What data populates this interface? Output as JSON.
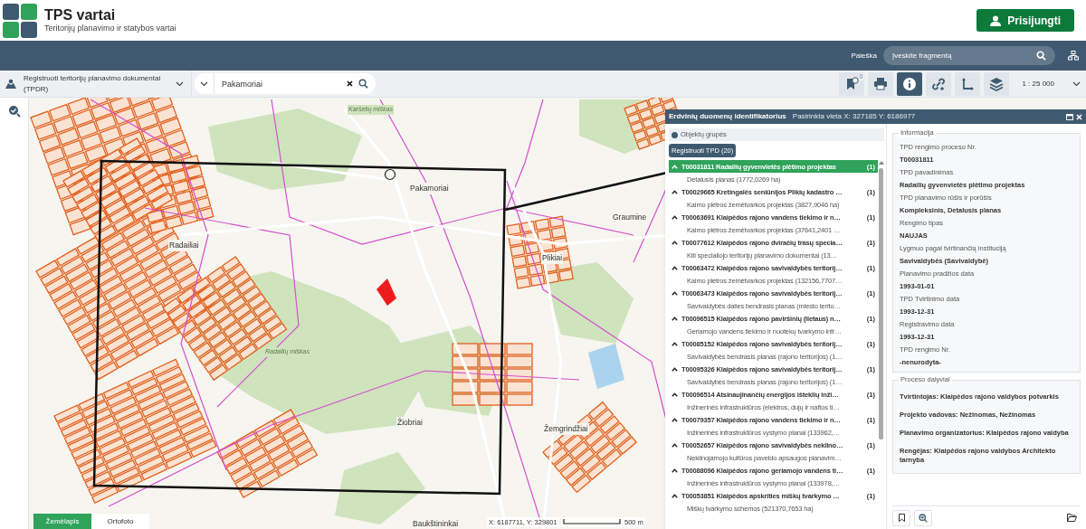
{
  "header": {
    "title": "TPS vartai",
    "subtitle": "Teritorijų planavimo ir statybos vartai",
    "login_button": "Prisijungti"
  },
  "nav_bar": {
    "search_label": "Paieška",
    "search_placeholder": "Įveskite fragmentą"
  },
  "toolbar": {
    "layer_select": "Registruoti teritorijų planavimo dokumentai (TPDR)",
    "search_value": "Pakamoriai",
    "tools": [
      {
        "kind": "bookmark",
        "badge": "0",
        "selected": false
      },
      {
        "kind": "print",
        "selected": false
      },
      {
        "kind": "info",
        "selected": true
      },
      {
        "kind": "link",
        "selected": false
      },
      {
        "kind": "axes",
        "selected": false
      },
      {
        "kind": "layers",
        "selected": false
      }
    ],
    "scale": "1 : 25 000"
  },
  "map": {
    "labels": [
      {
        "text": "Pakamoriai",
        "kind": "village"
      },
      {
        "text": "Radailiai",
        "kind": "village"
      },
      {
        "text": "Plikiai",
        "kind": "village"
      },
      {
        "text": "Graumine",
        "kind": "village"
      },
      {
        "text": "Žiobriai",
        "kind": "village"
      },
      {
        "text": "Žemgrindžiai",
        "kind": "village"
      },
      {
        "text": "Baukštininkai",
        "kind": "village"
      },
      {
        "text": "Radailių miškas",
        "kind": "forest"
      },
      {
        "text": "Karšelių miškas",
        "kind": "forest"
      }
    ],
    "base_tabs": [
      {
        "label": "Žemėlapis",
        "selected": true
      },
      {
        "label": "Ortofoto",
        "selected": false
      }
    ],
    "coordinates": "X: 6187711, Y: 329801",
    "scale_bar": "500 m"
  },
  "identify_panel": {
    "title": "Erdvinių duomenų identifikatorius",
    "location": "Pasirinkta vieta X: 327185 Y: 6186977",
    "group_label": "Objektų grupės",
    "group_tab": "Registruoti TPD (20)",
    "results": [
      {
        "title": "T00031811 Radailių gyvenvietės plėtimo projektas",
        "count": "(1)",
        "subtitle": "Detalusis planas (1772,0269 ha)",
        "selected": true
      },
      {
        "title": "T00029665 Kretingalės seniūnijos Plikių kadastro …",
        "count": "(1)",
        "subtitle": "Kaimo plėtros žemėtvarkos projektas (3827,9046 ha)",
        "selected": false
      },
      {
        "title": "T00063691 Klaipėdos rajono vandens tiekimo ir n…",
        "count": "(1)",
        "subtitle": "Kaimo plėtros žemėtvarkos projektas (37641,2401 …",
        "selected": false
      },
      {
        "title": "T00077612 Klaipėdos rajono dviračių trasų specia…",
        "count": "(1)",
        "subtitle": "Kiti specialiojo teritorijų planavimo dokumentai (13…",
        "selected": false
      },
      {
        "title": "T00063472 Klaipėdos rajono savivaldybės teritorij…",
        "count": "(1)",
        "subtitle": "Kaimo plėtros žemėtvarkos projektas (132156,7707…",
        "selected": false
      },
      {
        "title": "T00063473 Klaipėdos rajono savivaldybės teritorij…",
        "count": "(1)",
        "subtitle": "Savivaldybės dalies bendrasis planas (miesto terito…",
        "selected": false
      },
      {
        "title": "T00096515 Klaipėdos rajono paviršinių (lietaus) n…",
        "count": "(1)",
        "subtitle": "Geriamojo vandens tiekimo ir nuotekų tvarkymo infr…",
        "selected": false
      },
      {
        "title": "T00085152 Klaipėdos rajono savivaldybės teritorij…",
        "count": "(1)",
        "subtitle": "Savivaldybės bendrasis planas (rajono teritorijos) (1…",
        "selected": false
      },
      {
        "title": "T00095326 Klaipėdos rajono savivaldybės teritorij…",
        "count": "(1)",
        "subtitle": "Savivaldybės bendrasis planas (rajono teritorijos) (1…",
        "selected": false
      },
      {
        "title": "T00096514 Atsinaujinančių energijos išteklių inži…",
        "count": "(1)",
        "subtitle": "Inžinerinės infrastruktūros (elektros, dujų ir naftos ti…",
        "selected": false
      },
      {
        "title": "T00079357 Klaipėdos rajono vandens tiekimo ir n…",
        "count": "(1)",
        "subtitle": "Inžinerinės infrastruktūros vystymo planai (133962,…",
        "selected": false
      },
      {
        "title": "T00052657 Klaipėdos rajono savivaldybės nekilno…",
        "count": "(1)",
        "subtitle": "Nekilnojamojo kultūros paveldo apsaugos planavim…",
        "selected": false
      },
      {
        "title": "T00088096 Klaipėdos rajono geriamojo vandens ti…",
        "count": "(1)",
        "subtitle": "Inžinerinės infrastruktūros vystymo planai (133978,…",
        "selected": false
      },
      {
        "title": "T00053851 Klaipėdos apskrities miškų tvarkymo …",
        "count": "(1)",
        "subtitle": "Miškų tvarkymo schemos (521370,7653 ha)",
        "selected": false
      }
    ],
    "info": {
      "heading": "Informacija",
      "fields": [
        {
          "label": "TPD rengimo proceso Nr.",
          "value": "T00031811"
        },
        {
          "label": "TPD pavadinimas",
          "value": "Radailių gyvenvietės plėtimo projektas"
        },
        {
          "label": "TPD planavimo rūšis ir porūšis",
          "value": "Kompleksinis, Detalusis planas"
        },
        {
          "label": "Rengimo tipas",
          "value": "NAUJAS"
        },
        {
          "label": "Lygmuo pagal tvirtinančią instituciją",
          "value": "Savivaldybės (Savivaldybė)"
        },
        {
          "label": "Planavimo pradžios data",
          "value": "1993-01-01"
        },
        {
          "label": "TPD Tvirtinimo data",
          "value": "1993-12-31"
        },
        {
          "label": "Registravimo data",
          "value": "1993-12-31"
        },
        {
          "label": "TPD rengimo Nr.",
          "value": "-nenurodyta-"
        }
      ]
    },
    "participants": {
      "heading": "Proceso dalyviai",
      "items": [
        "Tvirtintojas: Klaipėdos rajono valdybos potvarkis",
        "Projekto vadovas: Nežinomas, Nežinomas",
        "Planavimo organizatorius: Klaipėdos rajono valdyba",
        "Rengėjas: Klaipėdos rajono valdybos Architekto tarnyba"
      ]
    }
  }
}
